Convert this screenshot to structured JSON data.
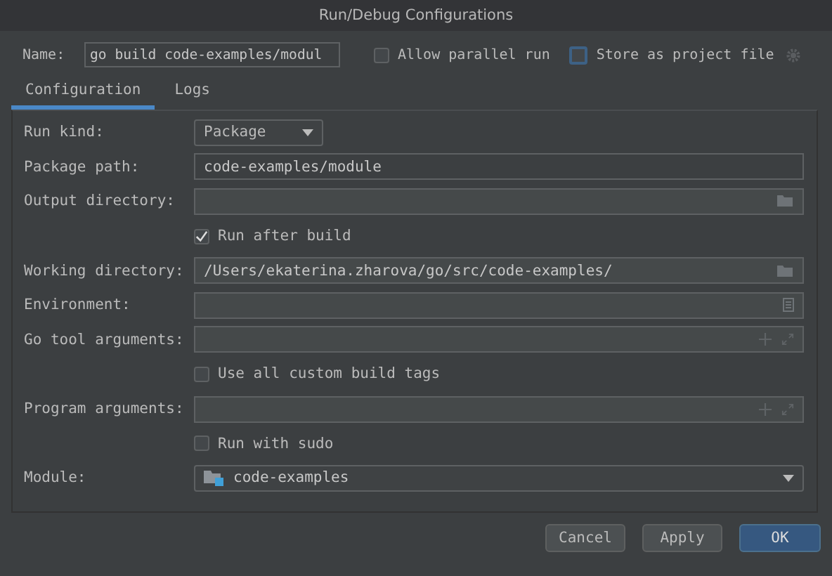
{
  "window": {
    "title": "Run/Debug Configurations"
  },
  "name": {
    "label": "Name:",
    "value": "go build code-examples/modul"
  },
  "options": [
    {
      "label": "Allow parallel run",
      "checked": false,
      "focused": false
    },
    {
      "label": "Store as project file",
      "checked": false,
      "focused": true
    }
  ],
  "tabs": [
    {
      "label": "Configuration",
      "selected": true
    },
    {
      "label": "Logs",
      "selected": false
    }
  ],
  "rows": [
    {
      "kind": "dropdown",
      "label": "Run kind:",
      "value": "Package"
    },
    {
      "kind": "text",
      "label": "Package path:",
      "value": "code-examples/module"
    },
    {
      "kind": "folder",
      "label": "Output directory:"
    },
    {
      "kind": "checkbox",
      "label": "Run after build",
      "checked": true
    },
    {
      "kind": "folder",
      "label": "Working directory:",
      "value": "/Users/ekaterina.zharova/go/src/code-examples/"
    },
    {
      "kind": "env",
      "label": "Environment:"
    },
    {
      "kind": "args",
      "label": "Go tool arguments:"
    },
    {
      "kind": "checkbox",
      "label": "Use all custom build tags",
      "checked": false
    },
    {
      "kind": "args",
      "label": "Program arguments:"
    },
    {
      "kind": "checkbox",
      "label": "Run with sudo",
      "checked": false
    },
    {
      "kind": "module",
      "label": "Module:",
      "value": "code-examples"
    }
  ],
  "buttons": [
    {
      "label": "Cancel",
      "default": false
    },
    {
      "label": "Apply",
      "default": false
    },
    {
      "label": "OK",
      "default": true
    }
  ]
}
